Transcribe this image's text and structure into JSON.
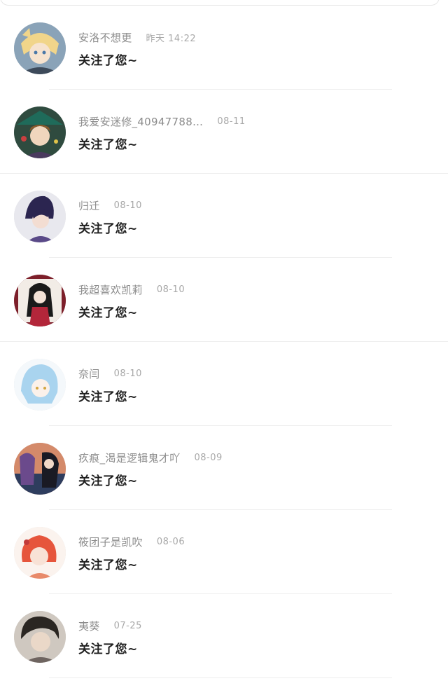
{
  "notifications": [
    {
      "name": "安洛不想更",
      "time": "昨天 14:22",
      "action": "关注了您~"
    },
    {
      "name": "我爱安迷修_40947788…",
      "time": "08-11",
      "action": "关注了您~"
    },
    {
      "name": "归迁",
      "time": "08-10",
      "action": "关注了您~"
    },
    {
      "name": "我超喜欢凯莉",
      "time": "08-10",
      "action": "关注了您~"
    },
    {
      "name": "奈闫",
      "time": "08-10",
      "action": "关注了您~"
    },
    {
      "name": "疚痕_渴是逻辑鬼才吖",
      "time": "08-09",
      "action": "关注了您~"
    },
    {
      "name": "筱团子是凯吹",
      "time": "08-06",
      "action": "关注了您~"
    },
    {
      "name": "夷葵",
      "time": "07-25",
      "action": "关注了您~"
    }
  ]
}
